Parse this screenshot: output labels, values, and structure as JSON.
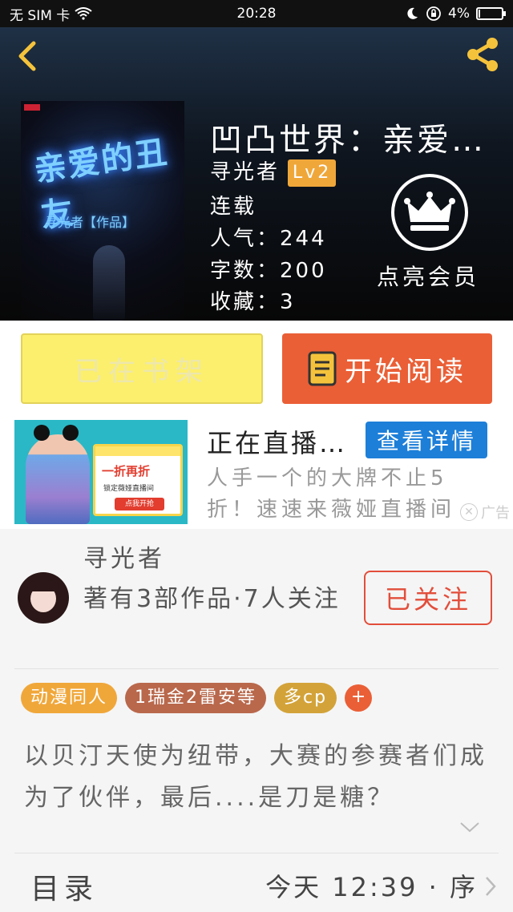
{
  "status_bar": {
    "carrier": "无 SIM 卡",
    "time": "20:28",
    "battery": "4%",
    "battery_level": 0.04
  },
  "book": {
    "cover_title": "亲爱的丑友",
    "cover_subtitle": "寻光者【作品】",
    "title": "凹凸世界：亲爱的丑友",
    "author": "寻光者",
    "level": "Lv2",
    "status": "连载",
    "popularity_label": "人气：",
    "popularity": "244",
    "words_label": "字数：",
    "words": "200",
    "favorites_label": "收藏：",
    "favorites": "3"
  },
  "vip": {
    "label": "点亮会员"
  },
  "actions": {
    "shelf_label": "已在书架",
    "read_label": "开始阅读"
  },
  "ad": {
    "image_title": "一折再折",
    "image_text": "锁定薇娅直播间",
    "image_button": "点我开抢",
    "title": "正在直播间...",
    "detail_label": "查看详情",
    "description": "人手一个的大牌不止5折！速速来薇娅直播间",
    "tag": "广告"
  },
  "author_card": {
    "name": "寻光者",
    "stats": "著有3部作品·7人关注",
    "follow_label": "已关注"
  },
  "tags": [
    {
      "label": "动漫同人",
      "color": "#f0a73a"
    },
    {
      "label": "1瑞金2雷安等",
      "color": "#b9684c"
    },
    {
      "label": "多cp",
      "color": "#d3a33a"
    }
  ],
  "tag_more": "+",
  "summary": "以贝汀天使为纽带，大赛的参赛者们成为了伙伴，最后....是刀是糖？",
  "toc": {
    "label": "目录",
    "update": "今天 12:39 · 序"
  },
  "colors": {
    "accent": "#ea5f36",
    "shelf": "#fcef6d",
    "follow": "#e24e3b",
    "ad_button": "#1d7fd8"
  },
  "icons": {
    "back": "chevron-left-icon",
    "share": "share-icon",
    "crown": "crown-icon",
    "book": "book-icon",
    "expand": "chevron-down-icon",
    "toc": "chevron-right-icon"
  }
}
